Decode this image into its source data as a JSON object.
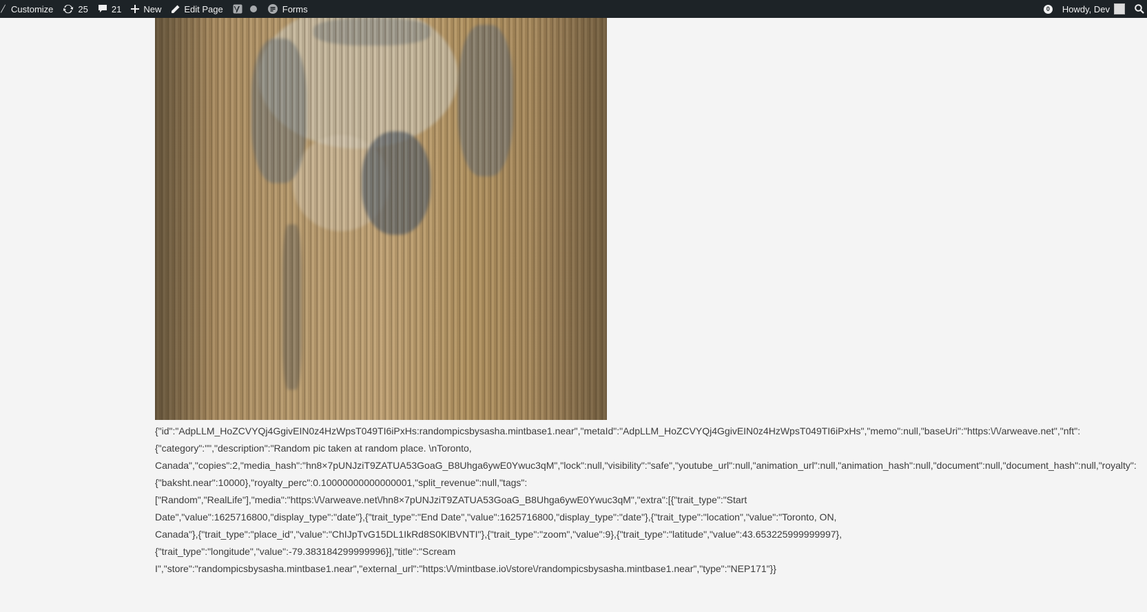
{
  "adminbar": {
    "customize_label": "Customize",
    "updates_count": "25",
    "comments_count": "21",
    "new_label": "New",
    "edit_page_label": "Edit Page",
    "forms_label": "Forms",
    "notification_count": "0",
    "greeting": "Howdy, Dev"
  },
  "icons": [
    "customize-icon",
    "updates-icon",
    "comments-icon",
    "plus-icon",
    "pencil-icon",
    "yoast-icon",
    "status-dot-icon",
    "forms-icon",
    "search-icon"
  ],
  "colors": {
    "adminbar_bg": "#1d2327",
    "adminbar_text": "#f0f0f1",
    "page_bg": "#f4f4f4",
    "body_text": "#3c3c3c"
  },
  "main": {
    "metadata_lines": [
      "{\"id\":\"AdpLLM_HoZCVYQj4GgivEIN0z4HzWpsT049TI6iPxHs:randompicsbysasha.mintbase1.near\",\"metaId\":\"AdpLLM_HoZCVYQj4GgivEIN0z4HzWpsT049TI6iPxHs\",\"memo\":null,\"baseUri\":\"https:\\/\\/arweave.net\",\"nft\":",
      "{\"category\":\"\",\"description\":\"Random pic taken at random place. \\nToronto,",
      "Canada\",\"copies\":2,\"media_hash\":\"hn8×7pUNJziT9ZATUA53GoaG_B8Uhga6ywE0Ywuc3qM\",\"lock\":null,\"visibility\":\"safe\",\"youtube_url\":null,\"animation_url\":null,\"animation_hash\":null,\"document\":null,\"document_hash\":null,\"royalty\":",
      "{\"baksht.near\":10000},\"royalty_perc\":0.10000000000000001,\"split_revenue\":null,\"tags\":",
      "[\"Random\",\"RealLife\"],\"media\":\"https:\\/\\/arweave.net\\/hn8×7pUNJziT9ZATUA53GoaG_B8Uhga6ywE0Ywuc3qM\",\"extra\":[{\"trait_type\":\"Start",
      "Date\",\"value\":1625716800,\"display_type\":\"date\"},{\"trait_type\":\"End Date\",\"value\":1625716800,\"display_type\":\"date\"},{\"trait_type\":\"location\",\"value\":\"Toronto, ON,",
      "Canada\"},{\"trait_type\":\"place_id\",\"value\":\"ChIJpTvG15DL1IkRd8S0KlBVNTI\"},{\"trait_type\":\"zoom\",\"value\":9},{\"trait_type\":\"latitude\",\"value\":43.653225999999997},",
      "{\"trait_type\":\"longitude\",\"value\":-79.383184299999996}],\"title\":\"Scream",
      "I\",\"store\":\"randompicsbysasha.mintbase1.near\",\"external_url\":\"https:\\/\\/mintbase.io\\/store\\/randompicsbysasha.mintbase1.near\",\"type\":\"NEP171\"}}"
    ]
  }
}
